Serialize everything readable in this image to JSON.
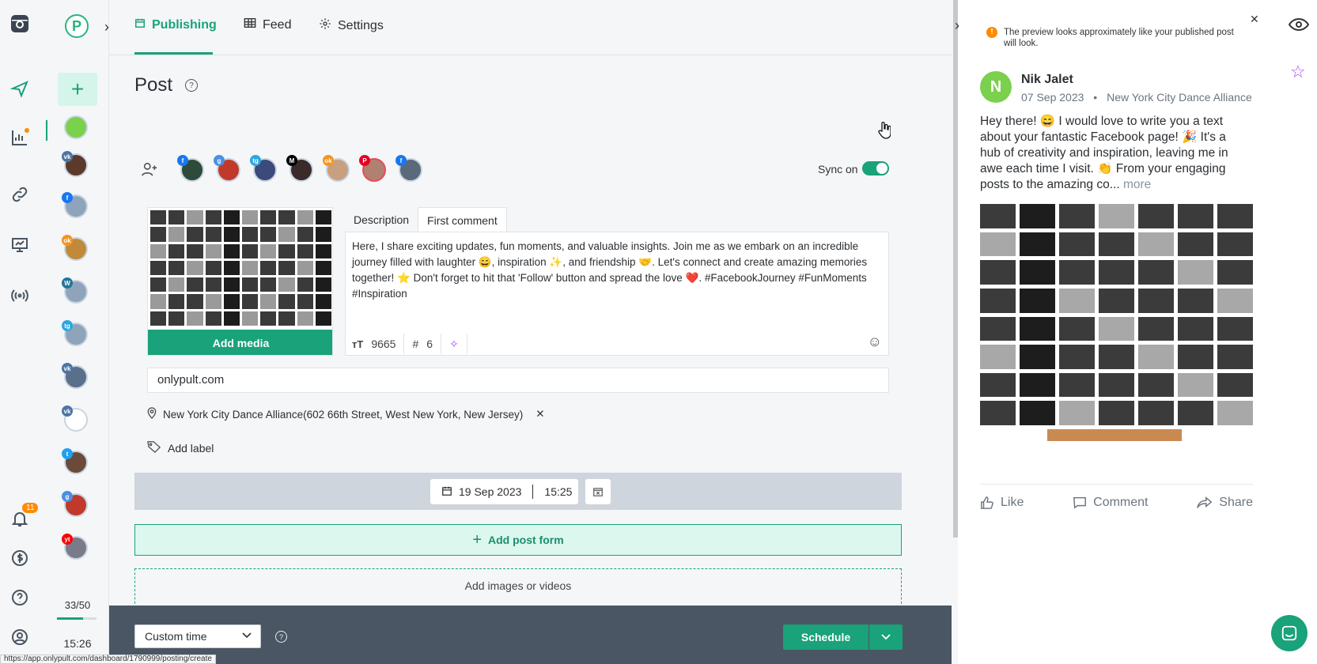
{
  "rail": {
    "notif_count": "11"
  },
  "accounts": {
    "counter": "33/50",
    "counter_progress": 0.66,
    "time": "15:26"
  },
  "nav": {
    "tabs": [
      {
        "label": "Publishing"
      },
      {
        "label": "Feed"
      },
      {
        "label": "Settings"
      }
    ]
  },
  "post": {
    "title": "Post",
    "help": "?",
    "sync_label": "Sync on",
    "add_media": "Add media",
    "desc_tabs": [
      "Description",
      "First comment"
    ],
    "description": "Here, I share exciting updates, fun moments, and valuable insights. Join me as we embark on an incredible journey filled with laughter 😄, inspiration ✨, and friendship 🤝. Let's connect and create amazing memories together! ⭐ Don't forget to hit that 'Follow' button and spread the love ❤️. #FacebookJourney #FunMoments #Inspiration",
    "char_count": "9665",
    "hashtag_count": "6",
    "link": "onlypult.com",
    "location": "New York City Dance Alliance(602 66th Street, West New York, New Jersey)",
    "add_label": "Add label",
    "date": "19 Sep 2023",
    "time": "15:25",
    "add_post_form": "Add post form",
    "add_images": "Add images or videos"
  },
  "bottom": {
    "custom_time": "Custom time",
    "schedule": "Schedule",
    "url": "https://app.onlypult.com/dashboard/1790999/posting/create"
  },
  "preview": {
    "warning": "The preview looks approximately like your published post will look.",
    "avatar_letter": "N",
    "name": "Nik Jalet",
    "date": "07 Sep 2023",
    "location": "New York City Dance Alliance",
    "text": "Hey there! 😄 I would love to write you a text about your fantastic Facebook page! 🎉 It's a hub of creativity and inspiration, leaving me in awe each time I visit. 👏 From your engaging posts to the amazing co...",
    "more": "more",
    "actions": {
      "like": "Like",
      "comment": "Comment",
      "share": "Share"
    }
  },
  "colors": {
    "accent": "#1aa27a",
    "warning": "#ff8a00",
    "bottom_bar": "#4a5663"
  }
}
